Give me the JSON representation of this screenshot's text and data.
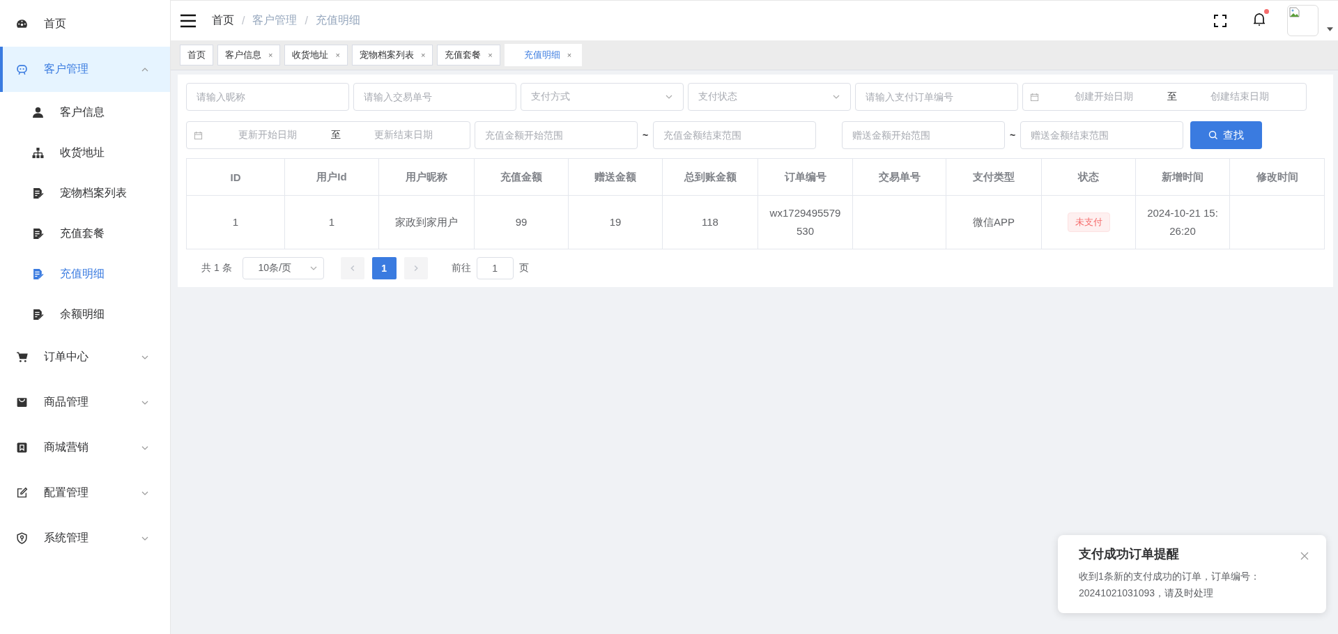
{
  "sidebar": {
    "items": [
      {
        "label": "首页",
        "selected": false
      },
      {
        "label": "客户管理",
        "selected": true,
        "expanded": true,
        "children": [
          {
            "label": "客户信息",
            "selected": false
          },
          {
            "label": "收货地址",
            "selected": false
          },
          {
            "label": "宠物档案列表",
            "selected": false
          },
          {
            "label": "充值套餐",
            "selected": false
          },
          {
            "label": "充值明细",
            "selected": true
          },
          {
            "label": "余额明细",
            "selected": false
          }
        ]
      },
      {
        "label": "订单中心",
        "selected": false,
        "expanded": false
      },
      {
        "label": "商品管理",
        "selected": false,
        "expanded": false
      },
      {
        "label": "商城营销",
        "selected": false,
        "expanded": false
      },
      {
        "label": "配置管理",
        "selected": false,
        "expanded": false
      },
      {
        "label": "系统管理",
        "selected": false,
        "expanded": false
      }
    ]
  },
  "header": {
    "breadcrumb": [
      {
        "label": "首页",
        "link": true
      },
      {
        "label": "客户管理",
        "link": false
      },
      {
        "label": "充值明细",
        "link": false
      }
    ],
    "breadcrumb_separator": "/",
    "bell": {
      "unread": true
    }
  },
  "tabs": [
    {
      "label": "首页",
      "selected": false,
      "closable": false
    },
    {
      "label": "客户信息",
      "selected": false,
      "closable": true
    },
    {
      "label": "收货地址",
      "selected": false,
      "closable": true
    },
    {
      "label": "宠物档案列表",
      "selected": false,
      "closable": true
    },
    {
      "label": "充值套餐",
      "selected": false,
      "closable": true
    },
    {
      "label": "充值明细",
      "selected": true,
      "closable": true
    }
  ],
  "tab_close": "×",
  "filter_rows": [
    {
      "fields": [
        {
          "kind": "text",
          "placeholder": "请输入昵称"
        },
        {
          "kind": "text",
          "placeholder": "请输入交易单号"
        },
        {
          "kind": "select",
          "placeholder": "支付方式"
        },
        {
          "kind": "select",
          "placeholder": "支付状态"
        },
        {
          "kind": "text",
          "placeholder": "请输入支付订单编号"
        },
        {
          "kind": "daterange",
          "start_placeholder": "创建开始日期",
          "separator": "至",
          "end_placeholder": "创建结束日期"
        }
      ]
    },
    {
      "fields": [
        {
          "kind": "daterange",
          "start_placeholder": "更新开始日期",
          "separator": "至",
          "end_placeholder": "更新结束日期"
        },
        {
          "kind": "range",
          "start_placeholder": "充值金额开始范围",
          "separator": "~",
          "end_placeholder": "充值金额结束范围"
        },
        {
          "kind": "range",
          "start_placeholder": "赠送金额开始范围",
          "separator": "~",
          "end_placeholder": "赠送金额结束范围"
        },
        {
          "kind": "button",
          "label": "查找"
        }
      ]
    }
  ],
  "table": {
    "columns": [
      {
        "label": "ID",
        "kind": "text"
      },
      {
        "label": "用户Id",
        "kind": "text"
      },
      {
        "label": "用户昵称",
        "kind": "text"
      },
      {
        "label": "充值金额",
        "kind": "text"
      },
      {
        "label": "赠送金额",
        "kind": "text"
      },
      {
        "label": "总到账金额",
        "kind": "text"
      },
      {
        "label": "订单编号",
        "kind": "text"
      },
      {
        "label": "交易单号",
        "kind": "text"
      },
      {
        "label": "支付类型",
        "kind": "text"
      },
      {
        "label": "状态",
        "kind": "tag"
      },
      {
        "label": "新增时间",
        "kind": "text"
      },
      {
        "label": "修改时间",
        "kind": "text"
      }
    ],
    "rows": [
      {
        "cells": [
          "1",
          "1",
          "家政到家用户",
          "99",
          "19",
          "118",
          "wx1729495579530",
          "",
          "微信APP",
          "未支付",
          "2024-10-21 15:26:20",
          ""
        ]
      }
    ]
  },
  "pagination": {
    "total": "共 1 条",
    "page_size": "10条/页",
    "prev_disabled": true,
    "next_disabled": true,
    "pages": [
      {
        "label": "1",
        "selected": true
      }
    ],
    "goto_label": "前往",
    "goto_value": "1",
    "goto_suffix": "页"
  },
  "notification": {
    "title": "支付成功订单提醒",
    "message": "收到1条新的支付成功的订单，订单编号：20241021031093，请及时处理"
  }
}
